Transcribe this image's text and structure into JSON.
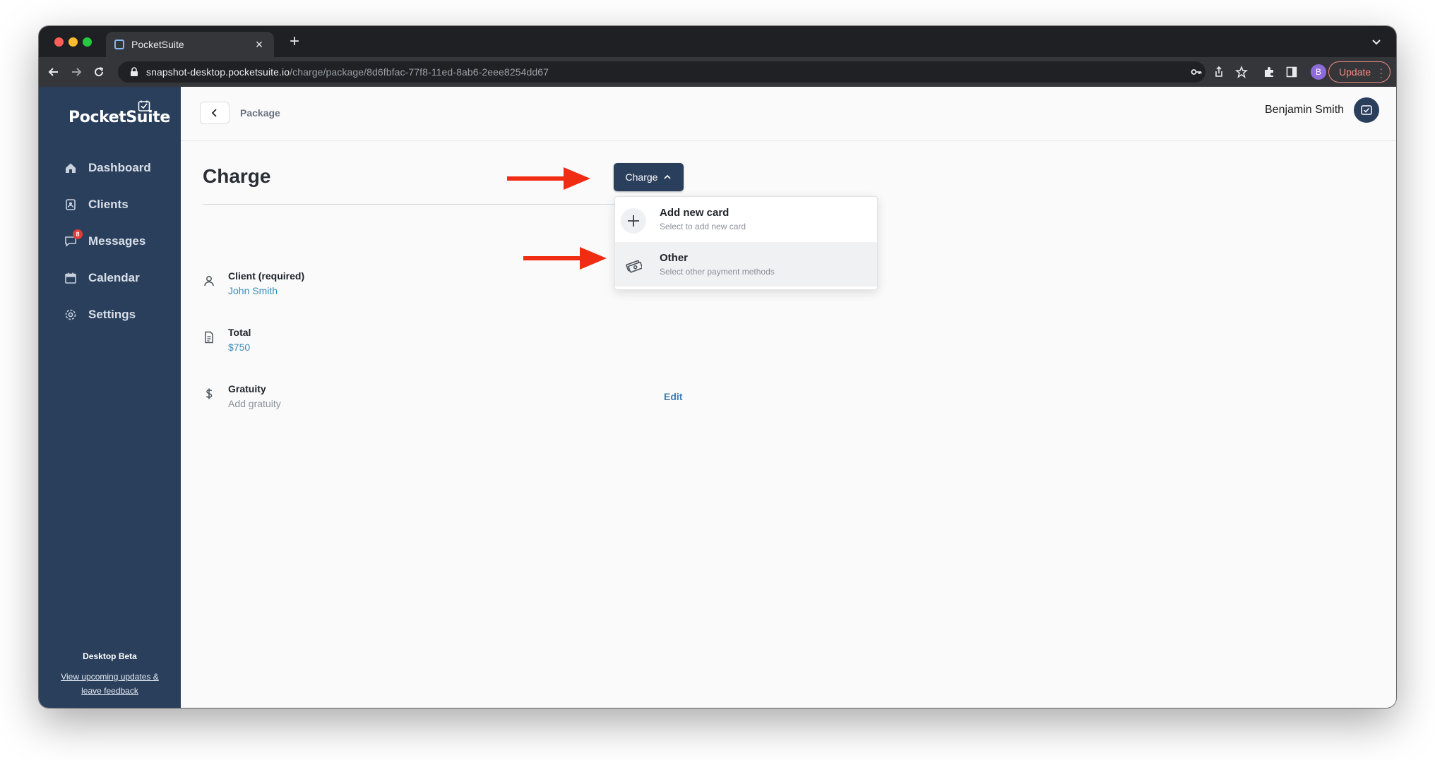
{
  "browser": {
    "tab_title": "PocketSuite",
    "url_host": "snapshot-desktop.pocketsuite.io",
    "url_path": "/charge/package/8d6fbfac-77f8-11ed-8ab6-2eee8254dd67",
    "profile_initial": "B",
    "update_label": "Update"
  },
  "sidebar": {
    "logo": "PocketSuite",
    "items": [
      {
        "label": "Dashboard",
        "icon": "home-icon"
      },
      {
        "label": "Clients",
        "icon": "clients-icon"
      },
      {
        "label": "Messages",
        "icon": "messages-icon",
        "badge": "8"
      },
      {
        "label": "Calendar",
        "icon": "calendar-icon"
      },
      {
        "label": "Settings",
        "icon": "gear-icon"
      }
    ],
    "beta_title": "Desktop Beta",
    "beta_link_line1": "View upcoming updates &",
    "beta_link_line2": "leave feedback"
  },
  "header": {
    "breadcrumb": "Package",
    "user_name": "Benjamin Smith"
  },
  "page": {
    "title": "Charge",
    "charge_button": "Charge",
    "dropdown": [
      {
        "title": "Add new card",
        "subtitle": "Select to add new card",
        "icon": "plus-icon"
      },
      {
        "title": "Other",
        "subtitle": "Select other payment methods",
        "icon": "cash-icon"
      }
    ],
    "fields": {
      "client": {
        "label": "Client (required)",
        "value": "John Smith"
      },
      "total": {
        "label": "Total",
        "value": "$750"
      },
      "gratuity": {
        "label": "Gratuity",
        "value": "Add gratuity",
        "action": "Edit"
      }
    }
  },
  "colors": {
    "sidebar": "#2a3f5c",
    "accent_link": "#3c8dbc",
    "annotation_arrow": "#f02d12"
  }
}
